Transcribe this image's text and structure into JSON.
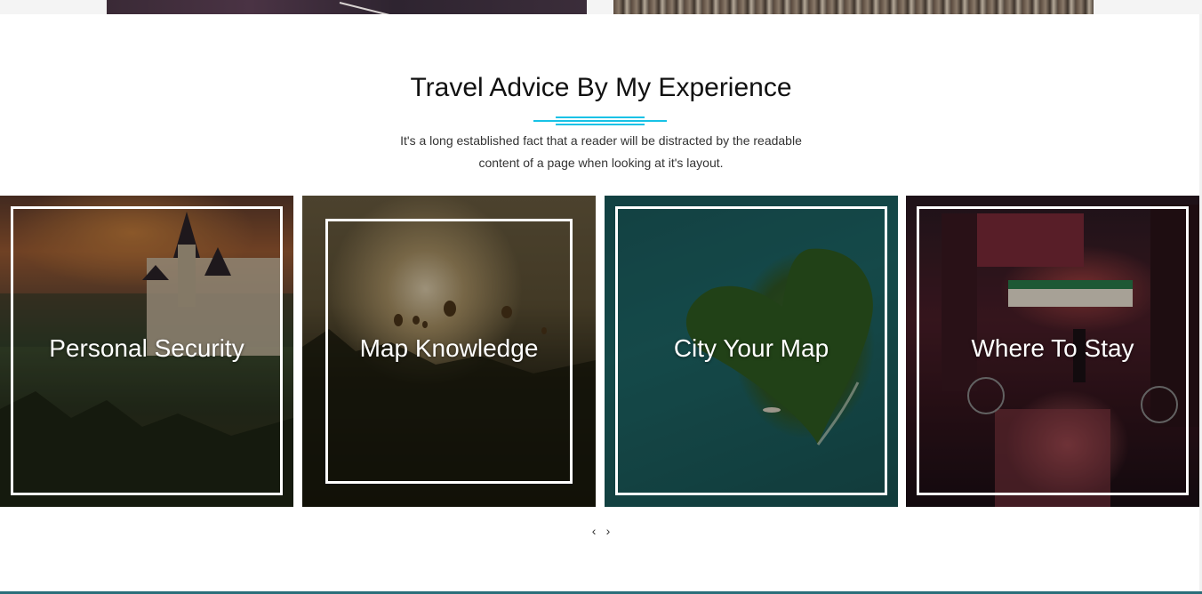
{
  "section": {
    "title": "Travel Advice By My Experience",
    "description_line1": "It's a long established fact that a reader will be distracted by the readable",
    "description_line2": "content of a page when looking at it's layout."
  },
  "cards": [
    {
      "title": "Personal Security",
      "image": "castle-sunset"
    },
    {
      "title": "Map Knowledge",
      "image": "hot-air-balloons"
    },
    {
      "title": "City Your Map",
      "image": "heart-island"
    },
    {
      "title": "Where To Stay",
      "image": "neon-street-night"
    }
  ],
  "carousel": {
    "prev_label": "‹",
    "next_label": "›"
  },
  "colors": {
    "accent": "#17c2e6",
    "title_text": "#111111",
    "card_text": "#ffffff"
  }
}
